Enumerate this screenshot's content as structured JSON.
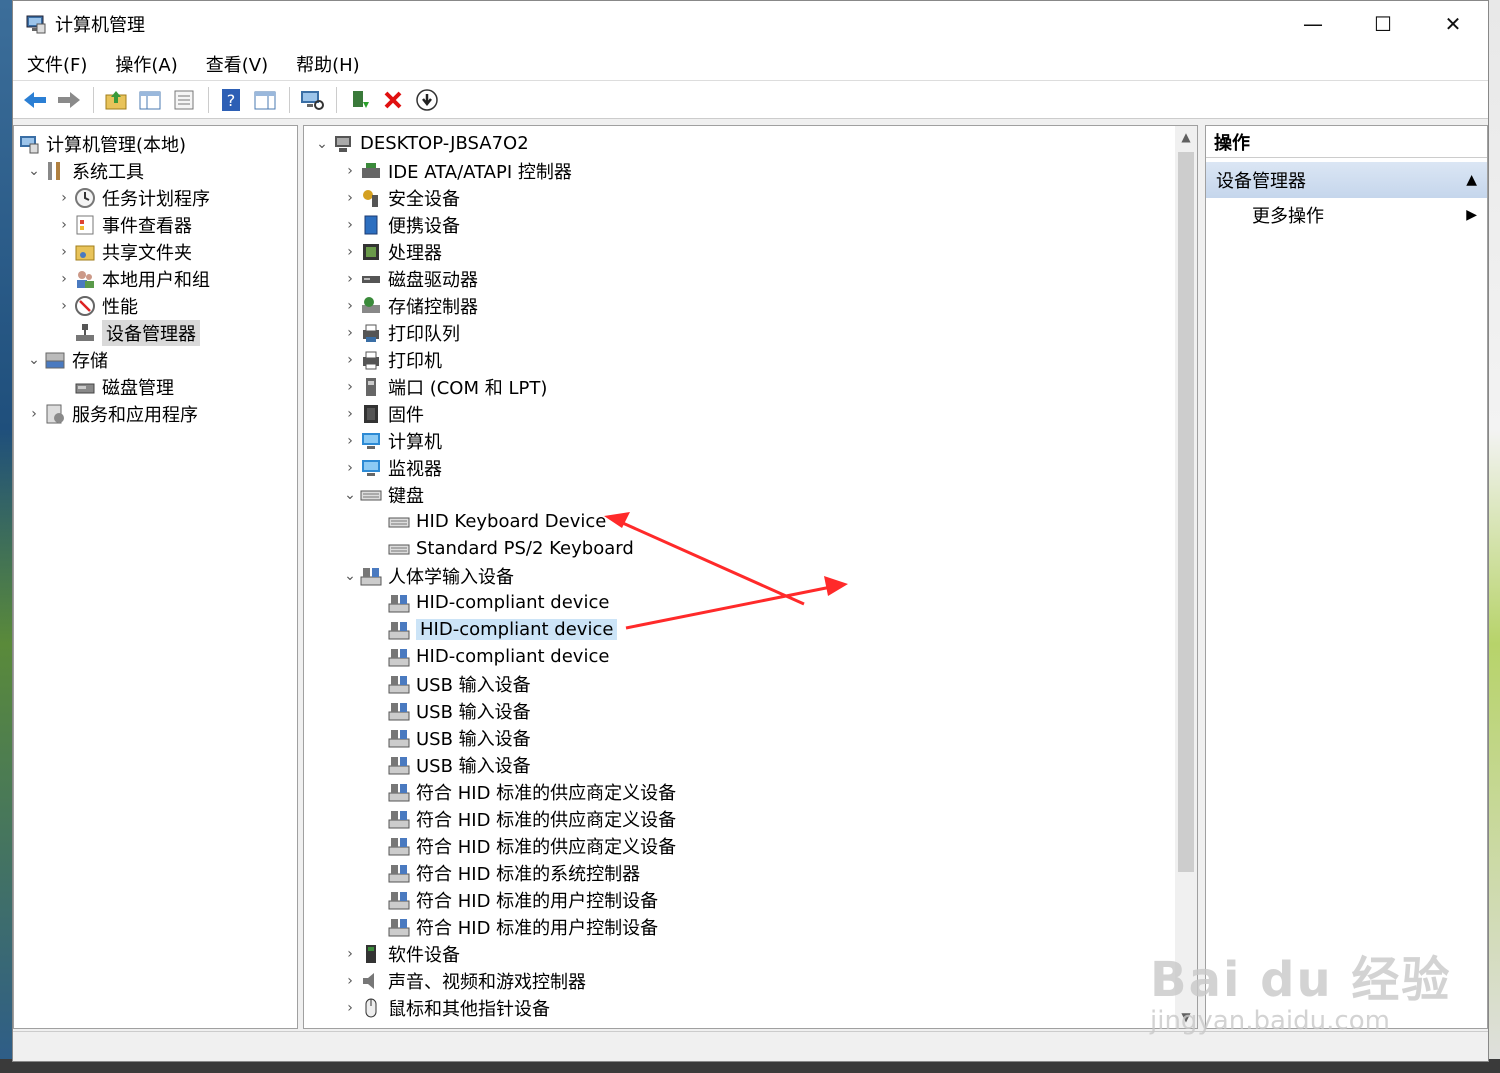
{
  "window": {
    "title": "计算机管理",
    "minimize": "—",
    "maximize": "☐",
    "close": "✕"
  },
  "menu": [
    "文件(F)",
    "操作(A)",
    "查看(V)",
    "帮助(H)"
  ],
  "left_tree": {
    "root": "计算机管理(本地)",
    "system_tools": "系统工具",
    "task_scheduler": "任务计划程序",
    "event_viewer": "事件查看器",
    "shared_folders": "共享文件夹",
    "local_users": "本地用户和组",
    "performance": "性能",
    "device_manager": "设备管理器",
    "storage": "存储",
    "disk_management": "磁盘管理",
    "services_apps": "服务和应用程序"
  },
  "device_tree": {
    "computer": "DESKTOP-JBSA7O2",
    "items": [
      {
        "label": "IDE ATA/ATAPI 控制器",
        "icon": "ide-controller-icon",
        "expanded": false
      },
      {
        "label": "安全设备",
        "icon": "security-device-icon",
        "expanded": false
      },
      {
        "label": "便携设备",
        "icon": "portable-device-icon",
        "expanded": false
      },
      {
        "label": "处理器",
        "icon": "processor-icon",
        "expanded": false
      },
      {
        "label": "磁盘驱动器",
        "icon": "disk-drive-icon",
        "expanded": false
      },
      {
        "label": "存储控制器",
        "icon": "storage-controller-icon",
        "expanded": false
      },
      {
        "label": "打印队列",
        "icon": "print-queue-icon",
        "expanded": false
      },
      {
        "label": "打印机",
        "icon": "printer-icon",
        "expanded": false
      },
      {
        "label": "端口 (COM 和 LPT)",
        "icon": "port-icon",
        "expanded": false
      },
      {
        "label": "固件",
        "icon": "firmware-icon",
        "expanded": false
      },
      {
        "label": "计算机",
        "icon": "computer-icon",
        "expanded": false
      },
      {
        "label": "监视器",
        "icon": "monitor-icon",
        "expanded": false
      },
      {
        "label": "键盘",
        "icon": "keyboard-icon",
        "expanded": true
      }
    ],
    "keyboard_children": [
      "HID Keyboard Device",
      "Standard PS/2 Keyboard"
    ],
    "hid_group": "人体学输入设备",
    "hid_children": [
      "HID-compliant device",
      "HID-compliant device",
      "HID-compliant device",
      "USB 输入设备",
      "USB 输入设备",
      "USB 输入设备",
      "USB 输入设备",
      "符合 HID 标准的供应商定义设备",
      "符合 HID 标准的供应商定义设备",
      "符合 HID 标准的供应商定义设备",
      "符合 HID 标准的系统控制器",
      "符合 HID 标准的用户控制设备",
      "符合 HID 标准的用户控制设备"
    ],
    "after_items": [
      {
        "label": "软件设备",
        "icon": "software-device-icon"
      },
      {
        "label": "声音、视频和游戏控制器",
        "icon": "sound-controller-icon"
      },
      {
        "label": "鼠标和其他指针设备",
        "icon": "mouse-icon"
      }
    ]
  },
  "actions": {
    "header": "操作",
    "section": "设备管理器",
    "more": "更多操作"
  },
  "watermark": {
    "brand": "Bai du 经验",
    "url": "jingyan.baidu.com"
  },
  "colors": {
    "annotation_arrow": "#ff2a2a",
    "selection": "#cce4f7"
  }
}
